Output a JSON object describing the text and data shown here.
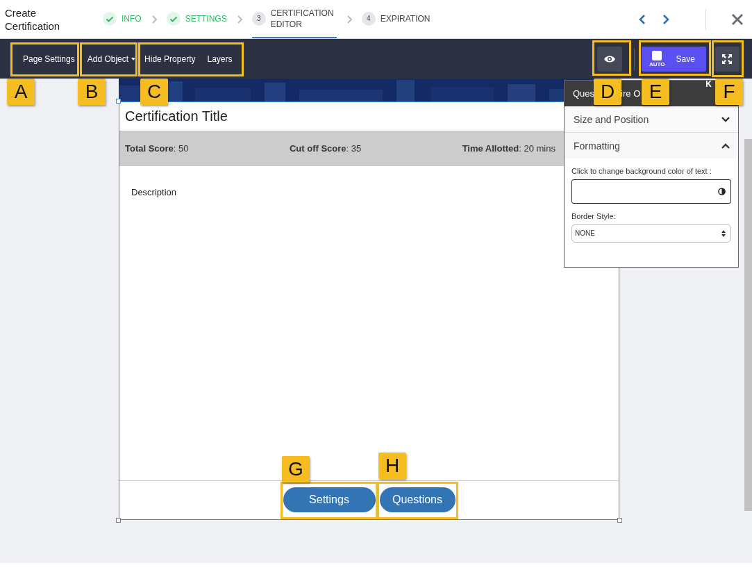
{
  "header": {
    "title": "Create Certification",
    "steps": [
      {
        "label": "INFO",
        "done": true,
        "selected": false
      },
      {
        "label": "SETTINGS",
        "done": true,
        "selected": false
      },
      {
        "number": "3",
        "label": "CERTIFICATION EDITOR",
        "done": false,
        "selected": true
      },
      {
        "number": "4",
        "label": "EXPIRATION",
        "done": false,
        "selected": false
      }
    ]
  },
  "toolbar": {
    "items": [
      {
        "label": "Page Settings",
        "kind": "plain"
      },
      {
        "label": "Add Object",
        "kind": "dropdown"
      },
      {
        "label": "Hide Property",
        "kind": "plain"
      },
      {
        "label": "Layers",
        "kind": "plain"
      }
    ],
    "save": {
      "badge": "AUTO",
      "label": "Save"
    }
  },
  "card": {
    "title": "Certification Title",
    "stats": [
      "**Total Score**: 50",
      "**Cut off Score**: 35",
      "**Time Allotted**: 20 mins"
    ],
    "description": "Description",
    "buttons": [
      "Settings",
      "Questions"
    ]
  },
  "panel": {
    "title_parts": [
      "Ques",
      "ire O"
    ],
    "corner": "K",
    "sections": [
      {
        "label": "Size and Position",
        "expanded": false
      },
      {
        "label": "Formatting",
        "expanded": true
      }
    ],
    "color_label": "Click to change background color of text :",
    "border_label": "Border Style:",
    "border_value": "NONE"
  },
  "callouts": [
    {
      "letter": "A"
    },
    {
      "letter": "B"
    },
    {
      "letter": "C"
    },
    {
      "letter": "D"
    },
    {
      "letter": "E"
    },
    {
      "letter": "F"
    },
    {
      "letter": "G"
    },
    {
      "letter": "H"
    }
  ]
}
